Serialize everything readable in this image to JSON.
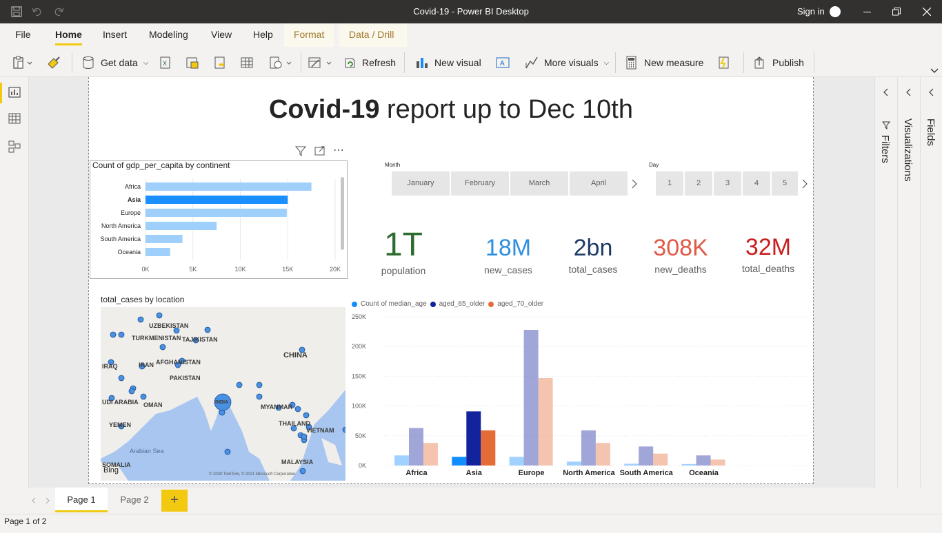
{
  "window": {
    "title": "Covid-19 - Power BI Desktop",
    "sign_in": "Sign in"
  },
  "menu": {
    "file": "File",
    "tabs": [
      "Home",
      "Insert",
      "Modeling",
      "View",
      "Help"
    ],
    "ctx_tabs": [
      "Format",
      "Data / Drill"
    ]
  },
  "ribbon": {
    "get_data": "Get data",
    "refresh": "Refresh",
    "new_visual": "New visual",
    "more_visuals": "More visuals",
    "new_measure": "New measure",
    "publish": "Publish"
  },
  "report": {
    "title_bold": "Covid-19",
    "title_rest": " report up to Dec 10th"
  },
  "bar_chart": {
    "title": "Count of gdp_per_capita by continent"
  },
  "slicers": {
    "month_label": "Month",
    "months": [
      "January",
      "February",
      "March",
      "April"
    ],
    "day_label": "Day",
    "days": [
      "1",
      "2",
      "3",
      "4",
      "5"
    ]
  },
  "kpis": [
    {
      "value": "1T",
      "label": "population",
      "color": "#2d6b2f"
    },
    {
      "value": "18M",
      "label": "new_cases",
      "color": "#2e8fe0"
    },
    {
      "value": "2bn",
      "label": "total_cases",
      "color": "#1e3b66"
    },
    {
      "value": "308K",
      "label": "new_deaths",
      "color": "#e05a48"
    },
    {
      "value": "32M",
      "label": "total_deaths",
      "color": "#c81e1e"
    }
  ],
  "map": {
    "title": "total_cases by location",
    "labels": [
      "UZBEKISTAN",
      "TURKMENISTAN",
      "TAJIKISTAN",
      "AFGHANISTAN",
      "IRAQ",
      "IRAN",
      "PAKISTAN",
      "CHINA",
      "INDIA",
      "UDI ARABIA",
      "OMAN",
      "MYANMAR",
      "YEMEN",
      "THAILAND",
      "VIETNAM",
      "Arabian Sea",
      "SOMALIA",
      "MALAYSIA"
    ],
    "bing": "Bing",
    "copyright": "© 2020 TomTom, © 2021 Microsoft Corporation"
  },
  "pages": {
    "tabs": [
      "Page 1",
      "Page 2"
    ],
    "add": "+"
  },
  "status": {
    "text": "Page 1 of 2"
  },
  "chart_data": [
    {
      "type": "bar",
      "orientation": "horizontal",
      "title": "Count of gdp_per_capita by continent",
      "categories": [
        "Africa",
        "Asia",
        "Europe",
        "North America",
        "South America",
        "Oceania"
      ],
      "values": [
        17500,
        15000,
        14900,
        7500,
        3900,
        2600
      ],
      "xlim": [
        0,
        20000
      ],
      "xticks": [
        "0K",
        "5K",
        "10K",
        "15K",
        "20K"
      ],
      "highlight": "Asia",
      "colors": {
        "normal": "#9fd0fb",
        "highlight": "#1a8fff"
      }
    },
    {
      "type": "bar",
      "title": "",
      "categories": [
        "Africa",
        "Asia",
        "Europe",
        "North America",
        "South America",
        "Oceania"
      ],
      "series": [
        {
          "name": "Count of median_age",
          "values": [
            17000,
            14500,
            14500,
            6500,
            3000,
            2500
          ],
          "color": "#118dff"
        },
        {
          "name": "aged_65_older",
          "values": [
            63000,
            91000,
            228000,
            59000,
            32000,
            17000
          ],
          "color": "#12239e"
        },
        {
          "name": "aged_70_older",
          "values": [
            38000,
            59000,
            147000,
            38000,
            20000,
            10000
          ],
          "color": "#e66c37"
        }
      ],
      "highlight": "Asia",
      "ylim": [
        0,
        250000
      ],
      "yticks": [
        "0K",
        "50K",
        "100K",
        "150K",
        "200K",
        "250K"
      ],
      "legend": "top-left"
    }
  ]
}
